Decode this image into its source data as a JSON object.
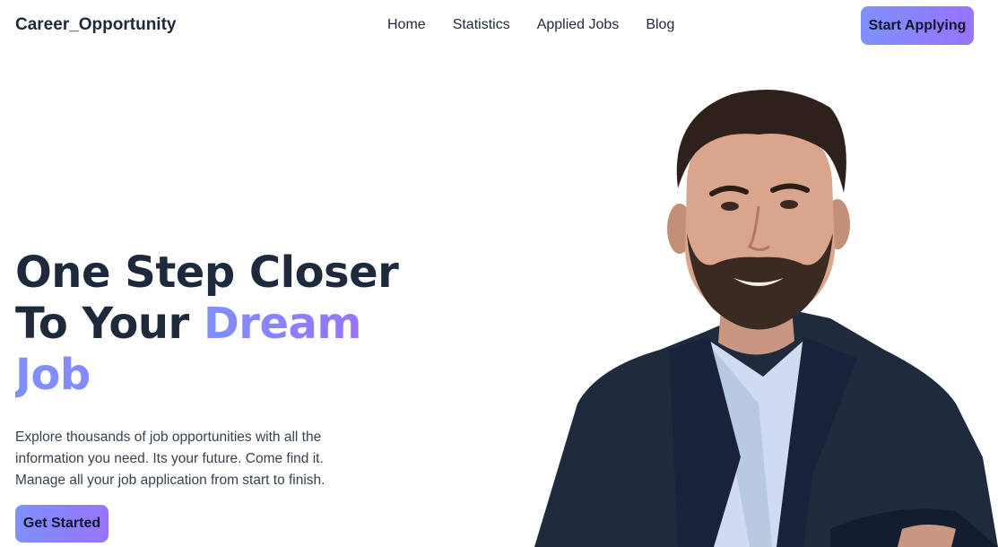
{
  "brand": {
    "name": "Career_Opportunity"
  },
  "nav": {
    "items": [
      {
        "label": "Home"
      },
      {
        "label": "Statistics"
      },
      {
        "label": "Applied Jobs"
      },
      {
        "label": "Blog"
      }
    ],
    "cta_label": "Start Applying"
  },
  "hero": {
    "title_line1": "One Step Closer",
    "title_line2_plain": "To Your ",
    "title_line2_accent": "Dream",
    "title_line3_accent": "Job",
    "description": [
      "Explore thousands of job opportunities with all the",
      "information you need. Its your future. Come find it.",
      "Manage all your job application from start to finish."
    ],
    "button_label": "Get Started",
    "image_alt": "smiling man in dark blazer"
  },
  "colors": {
    "accent_start": "#7e90fe",
    "accent_end": "#9873ff",
    "heading": "#1e293b"
  }
}
